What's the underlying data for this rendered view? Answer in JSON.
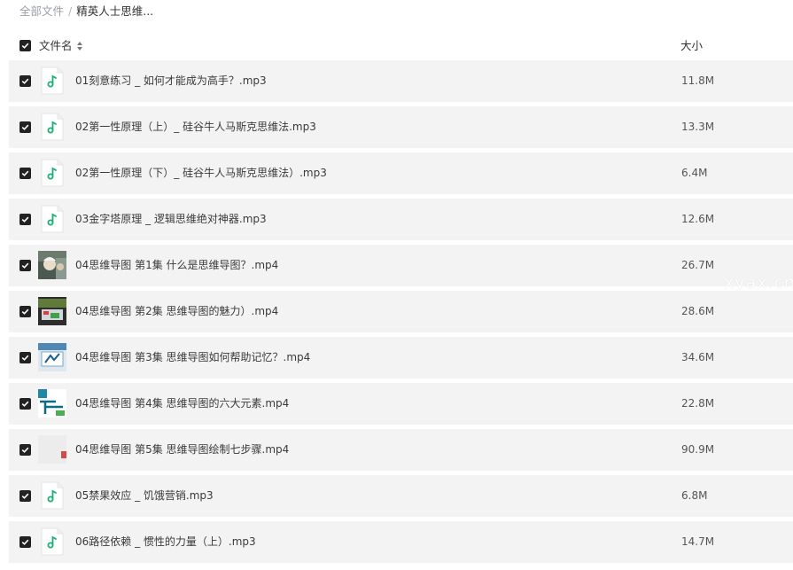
{
  "breadcrumb": {
    "root": "全部文件",
    "separator": "/",
    "current": "精英人士思维..."
  },
  "header": {
    "name_label": "文件名",
    "size_label": "大小"
  },
  "files": [
    {
      "name": "01刻意练习 _ 如何才能成为高手？.mp3",
      "size": "11.8M",
      "icon": "music-file-icon"
    },
    {
      "name": "02第一性原理（上）_ 硅谷牛人马斯克思维法.mp3",
      "size": "13.3M",
      "icon": "music-file-icon"
    },
    {
      "name": "02第一性原理（下）_ 硅谷牛人马斯克思维法）.mp3",
      "size": "6.4M",
      "icon": "music-file-icon"
    },
    {
      "name": "03金字塔原理 _ 逻辑思维绝对神器.mp3",
      "size": "12.6M",
      "icon": "music-file-icon"
    },
    {
      "name": "04思维导图 第1集 什么是思维导图？.mp4",
      "size": "26.7M",
      "icon": "video-thumbnail-1"
    },
    {
      "name": "04思维导图 第2集 思维导图的魅力）.mp4",
      "size": "28.6M",
      "icon": "video-thumbnail-2"
    },
    {
      "name": "04思维导图 第3集 思维导图如何帮助记忆？.mp4",
      "size": "34.6M",
      "icon": "video-thumbnail-3"
    },
    {
      "name": "04思维导图 第4集 思维导图的六大元素.mp4",
      "size": "22.8M",
      "icon": "video-thumbnail-4"
    },
    {
      "name": "04思维导图 第5集 思维导图绘制七步骤.mp4",
      "size": "90.9M",
      "icon": "video-thumbnail-5"
    },
    {
      "name": "05禁果效应 _ 饥饿营销.mp3",
      "size": "6.8M",
      "icon": "music-file-icon"
    },
    {
      "name": "06路径依赖 _ 惯性的力量（上）.mp3",
      "size": "14.7M",
      "icon": "music-file-icon"
    }
  ],
  "watermark": "xyax.cn",
  "colors": {
    "row_bg": "#f3f3f3",
    "music_icon": "#1cae74",
    "checkbox": "#222222"
  }
}
